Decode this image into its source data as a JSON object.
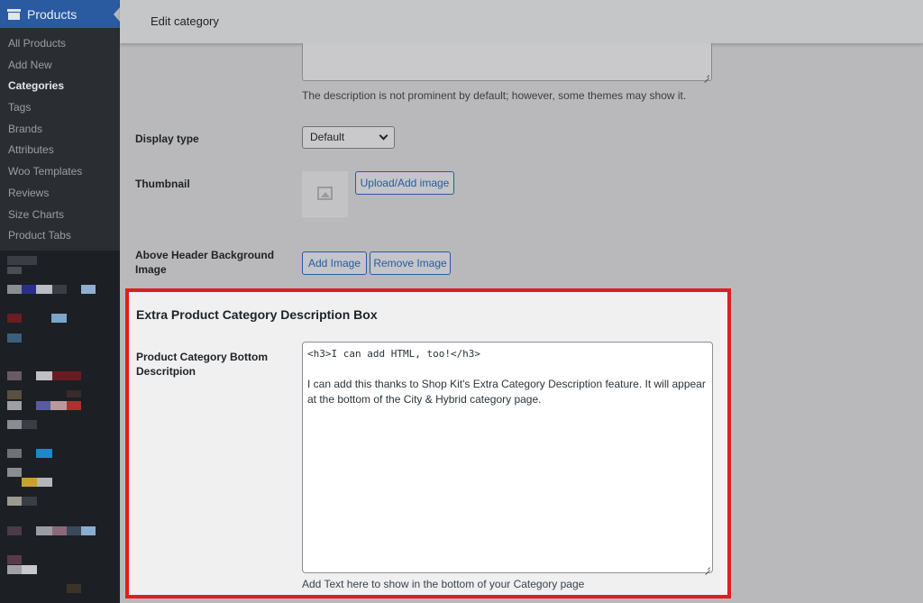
{
  "sidebar": {
    "menu_title": "Products",
    "menu_icon": "products-icon",
    "items": [
      {
        "label": "All Products"
      },
      {
        "label": "Add New"
      },
      {
        "label": "Categories",
        "current": true
      },
      {
        "label": "Tags"
      },
      {
        "label": "Brands"
      },
      {
        "label": "Attributes"
      },
      {
        "label": "Woo Templates"
      },
      {
        "label": "Reviews"
      },
      {
        "label": "Size Charts"
      },
      {
        "label": "Product Tabs"
      }
    ]
  },
  "header": {
    "title": "Edit category"
  },
  "form": {
    "description_help": "The description is not prominent by default; however, some themes may show it.",
    "display_type": {
      "label": "Display type",
      "selected": "Default"
    },
    "thumbnail": {
      "label": "Thumbnail",
      "button": "Upload/Add image",
      "placeholder_icon": "image-placeholder-icon"
    },
    "above_header": {
      "label": "Above Header Background Image",
      "add_button": "Add Image",
      "remove_button": "Remove Image"
    },
    "extra_box": {
      "title": "Extra Product Category Description Box",
      "field_label": "Product Category Bottom Descritpion",
      "value_line1": "<h3>I can add HTML, too!</h3>",
      "value_line2": "I can add this thanks to Shop Kit's Extra Category Description feature. It will appear at the bottom of the City & Hybrid category page.",
      "help": "Add Text here to show in the bottom of your Category page"
    }
  },
  "colors": {
    "highlight_border": "#e11d1d",
    "admin_blue": "#2a5aa0",
    "sidebar_bg": "#1c1f23"
  }
}
